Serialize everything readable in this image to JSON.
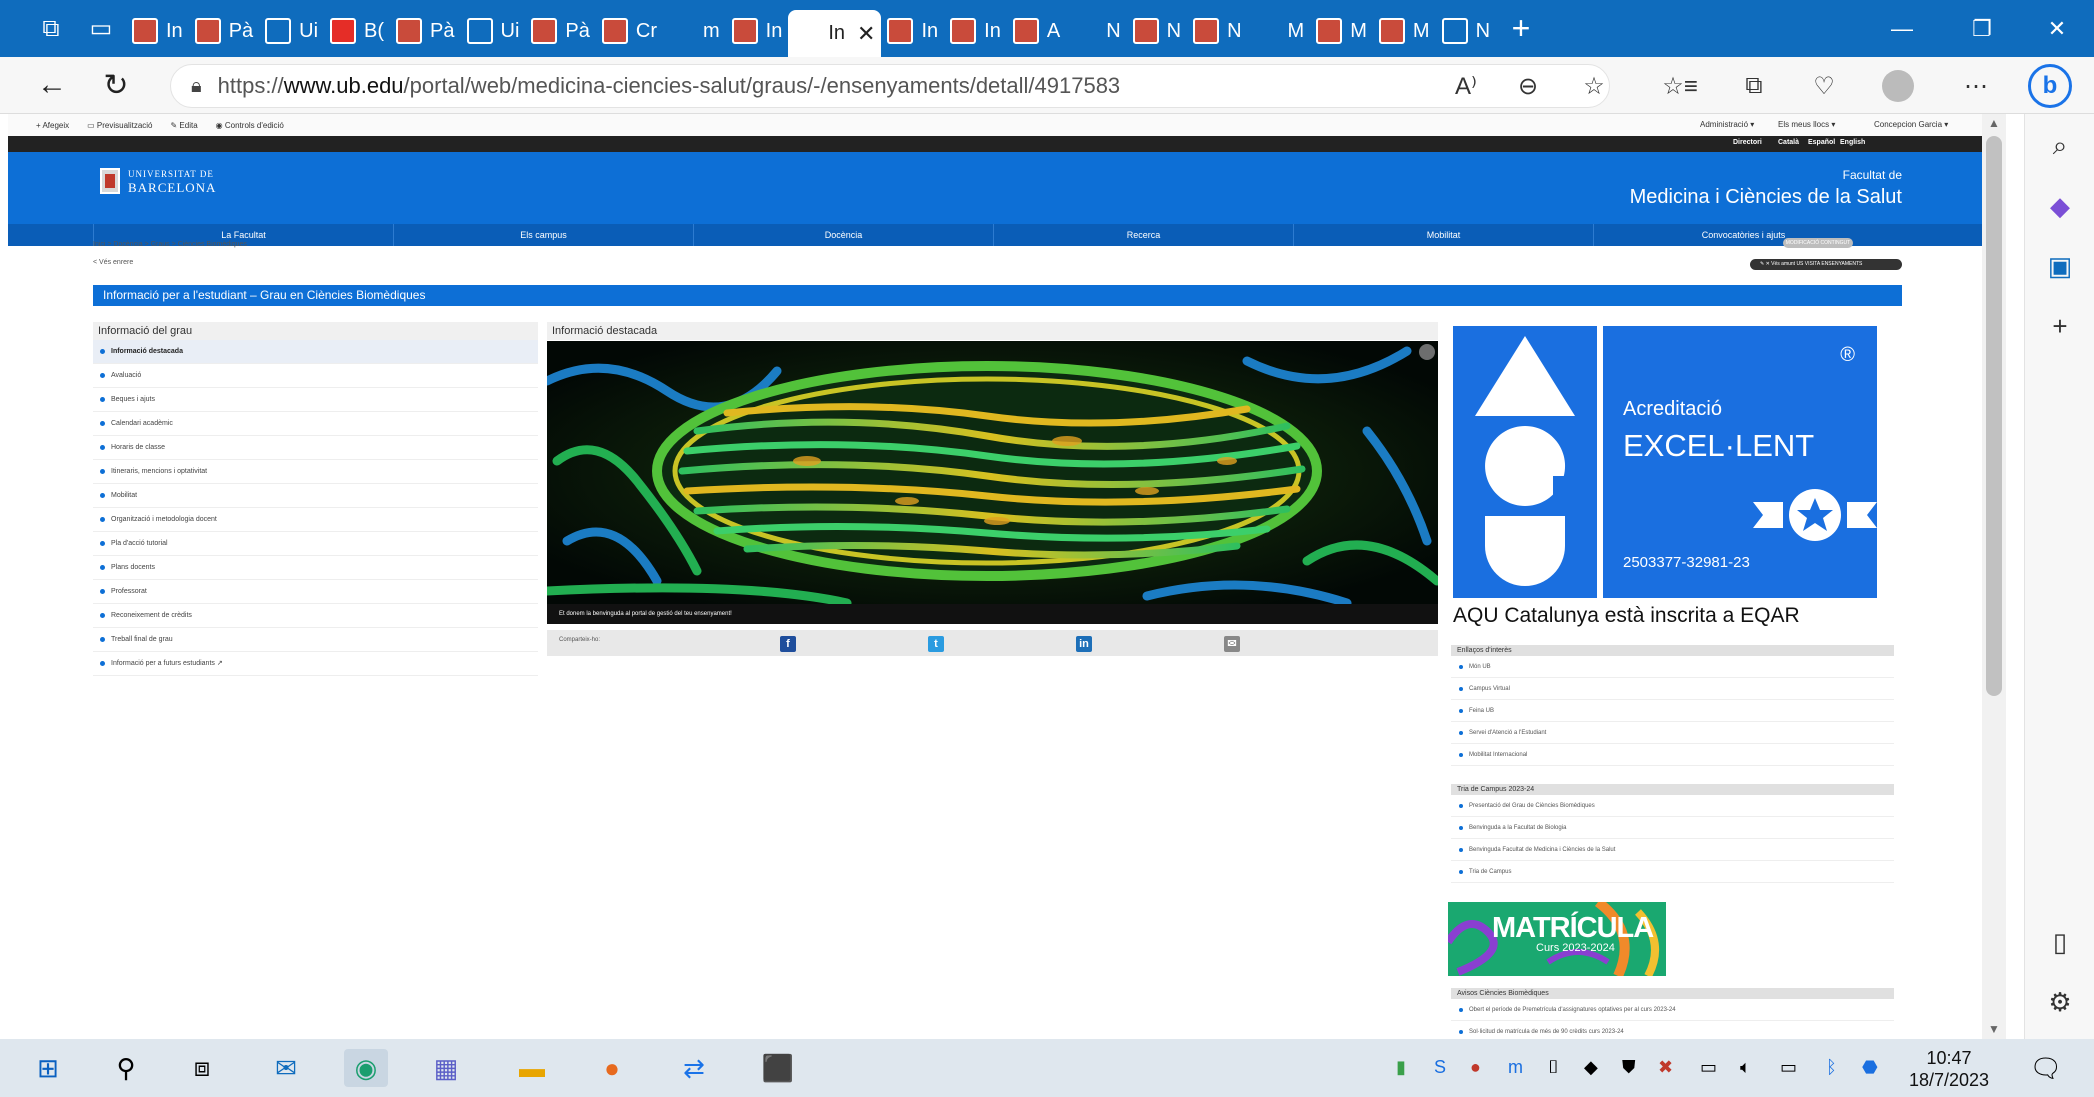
{
  "browser": {
    "tabs": [
      {
        "label": "In",
        "fav": "ub"
      },
      {
        "label": "Pà",
        "fav": "ub"
      },
      {
        "label": "Ui",
        "fav": "doc"
      },
      {
        "label": "B(",
        "fav": "pdf"
      },
      {
        "label": "Pà",
        "fav": "ub"
      },
      {
        "label": "Ui",
        "fav": "doc"
      },
      {
        "label": "Pà",
        "fav": "ub"
      },
      {
        "label": "Cr",
        "fav": "ub"
      },
      {
        "label": "m",
        "fav": "blank"
      },
      {
        "label": "In",
        "fav": "ub"
      },
      {
        "label": "In",
        "fav": "blank",
        "active": true
      },
      {
        "label": "In",
        "fav": "ub"
      },
      {
        "label": "In",
        "fav": "ub"
      },
      {
        "label": "A",
        "fav": "ub"
      },
      {
        "label": "N",
        "fav": "blank"
      },
      {
        "label": "N",
        "fav": "ub"
      },
      {
        "label": "N",
        "fav": "ub"
      },
      {
        "label": "M",
        "fav": "blank"
      },
      {
        "label": "M",
        "fav": "ub"
      },
      {
        "label": "M",
        "fav": "ub"
      },
      {
        "label": "N",
        "fav": "doc"
      }
    ],
    "url_prefix": "https://",
    "url_host": "www.ub.edu",
    "url_path": "/portal/web/medicina-ciencies-salut/graus/-/ensenyaments/detall/4917583",
    "new_tab": "+",
    "minimize": "—",
    "maximize": "❐",
    "close": "✕"
  },
  "admin_bar": {
    "left": [
      "+ Afegeix",
      "▭ Previsualització",
      "✎ Edita",
      "◉ Controls d'edició"
    ],
    "right": [
      "Administració ▾",
      "Els meus llocs ▾",
      "Concepcion Garcia ▾"
    ]
  },
  "lang_bar": [
    "Directori",
    "Català",
    "Español",
    "English"
  ],
  "header": {
    "logo_line1": "UNIVERSITAT DE",
    "logo_line2": "BARCELONA",
    "faculty_sub": "Facultat de",
    "faculty_title": "Medicina i Ciències de la Salut"
  },
  "nav": [
    "La Facultat",
    "Els campus",
    "Docència",
    "Recerca",
    "Mobilitat",
    "Convocatòries i ajuts"
  ],
  "breadcrumb": "Inici > Docència > Graus > Ciències Biomèdiques",
  "back_link": "< Vés enrere",
  "grey_pill": "MODIFICACIÓ CONTINGUT",
  "dark_pill": "✎  ✕  Vés amunt     US VISITA ENSENYAMENTS",
  "info_title": "Informació per a l'estudiant – Grau en Ciències Biomèdiques",
  "grau_panel": {
    "title": "Informació del grau",
    "items": [
      "Informació destacada",
      "Avaluació",
      "Beques i ajuts",
      "Calendari acadèmic",
      "Horaris de classe",
      "Itineraris, mencions i optativitat",
      "Mobilitat",
      "Organització i metodologia docent",
      "Pla d'acció tutorial",
      "Plans docents",
      "Professorat",
      "Reconeixement de crèdits",
      "Treball final de grau",
      "Informació per a futurs estudiants ↗"
    ]
  },
  "featured": {
    "title": "Informació destacada",
    "caption": "Et donem la benvinguda al portal de gestió del teu ensenyament!",
    "share_label": "Comparteix-ho:"
  },
  "aqu": {
    "mark": "®",
    "line1": "Acreditació",
    "line2": "EXCEL·LENT",
    "code": "2503377-32981-23",
    "caption": "AQU Catalunya està inscrita a EQAR"
  },
  "enllacos": {
    "title": "Enllaços d'interès",
    "items": [
      "Món UB",
      "Campus Virtual",
      "Feina UB",
      "Servei d'Atenció a l'Estudiant",
      "Mobilitat Internacional"
    ]
  },
  "tria": {
    "title": "Tria de Campus 2023-24",
    "items": [
      "Presentació del Grau de Ciències Biomèdiques",
      "Benvinguda a la Facultat de Biologia",
      "Benvinguda Facultat de Medicina i Ciències de la Salut",
      "Tria de Campus"
    ]
  },
  "matricula": {
    "title": "MATRÍCULA",
    "sub": "Curs 2023-2024"
  },
  "avisos": {
    "title": "Avisos Ciències Biomèdiques",
    "items": [
      "Obert el període de Premetrícula d'assignatures optatives per al curs 2023-24",
      "Sol·licitud de matrícula de més de 90 crèdits curs 2023-24"
    ]
  },
  "taskbar": {
    "time": "10:47",
    "date": "18/7/2023"
  },
  "colors": {
    "edge_blue": "#0f6cbd",
    "ub_blue": "#0d6fd6",
    "aqu_blue": "#1a6fe0"
  }
}
